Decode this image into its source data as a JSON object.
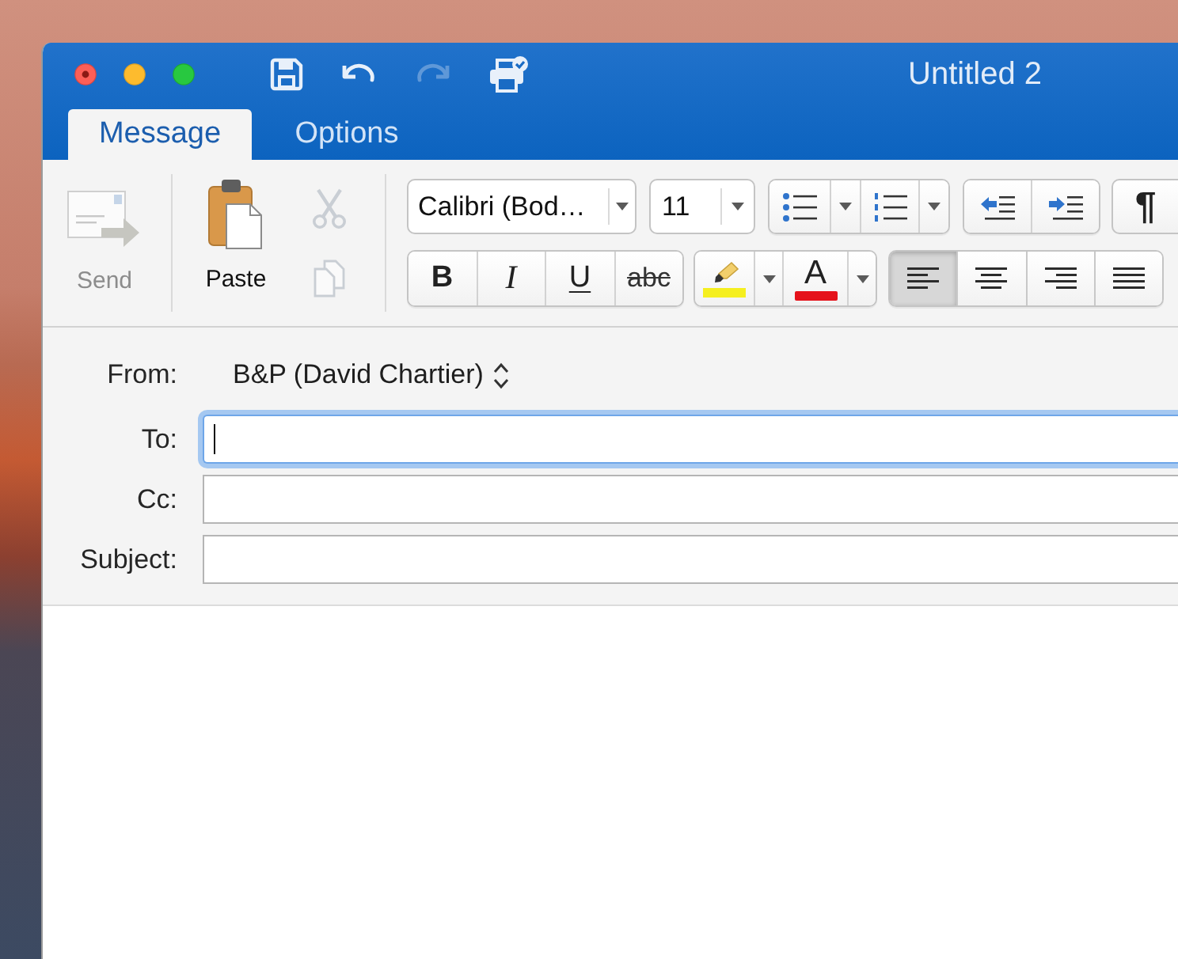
{
  "window": {
    "title": "Untitled 2"
  },
  "quick_access": [
    {
      "kind": "save",
      "disabled": false
    },
    {
      "kind": "undo",
      "disabled": false
    },
    {
      "kind": "redo",
      "disabled": true
    },
    {
      "kind": "print",
      "disabled": false
    }
  ],
  "tabs": [
    {
      "label": "Message",
      "selected": true
    },
    {
      "label": "Options",
      "selected": false
    }
  ],
  "ribbon": {
    "send": {
      "label": "Send",
      "disabled": true
    },
    "paste": {
      "label": "Paste",
      "disabled": false
    },
    "clipboard_tools": [
      {
        "kind": "cut",
        "disabled": true
      },
      {
        "kind": "copy",
        "disabled": true
      }
    ],
    "font": {
      "value": "Calibri (Bod…"
    },
    "font_size": {
      "value": "11"
    },
    "list_tools": [
      {
        "kind": "bullets"
      },
      {
        "kind": "numbering"
      }
    ],
    "indent_tools": [
      {
        "kind": "decrease"
      },
      {
        "kind": "increase"
      }
    ],
    "show_formatting": {
      "label": "¶"
    },
    "text_styles": [
      {
        "kind": "bold",
        "label": "B"
      },
      {
        "kind": "italic",
        "label": "I"
      },
      {
        "kind": "underline",
        "label": "U"
      },
      {
        "kind": "strikethrough",
        "label": "abc"
      }
    ],
    "color_tools": [
      {
        "kind": "highlight",
        "color": "#f5ef1f"
      },
      {
        "kind": "font_color",
        "label": "A",
        "color": "#e5121b"
      }
    ],
    "alignment": [
      {
        "kind": "left",
        "selected": true
      },
      {
        "kind": "center",
        "selected": false
      },
      {
        "kind": "right",
        "selected": false
      },
      {
        "kind": "justify",
        "selected": false
      }
    ]
  },
  "header": {
    "from": {
      "label": "From:",
      "value": "B&P (David Chartier)"
    },
    "fields": [
      {
        "label": "To:",
        "focused": true
      },
      {
        "label": "Cc:",
        "focused": false
      },
      {
        "label": "Subject:",
        "focused": false
      }
    ]
  }
}
